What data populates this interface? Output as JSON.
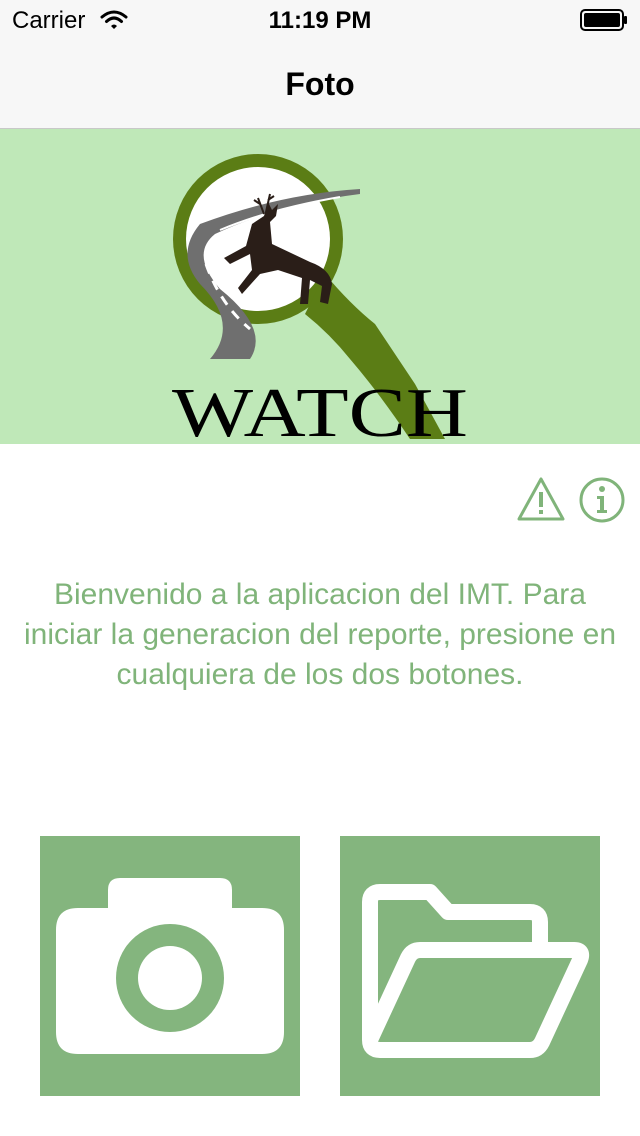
{
  "status_bar": {
    "carrier": "Carrier",
    "time": "11:19 PM"
  },
  "nav": {
    "title": "Foto"
  },
  "logo": {
    "text": "WATCH"
  },
  "welcome_message": "Bienvenido a la aplicacion del IMT. Para iniciar la generacion del reporte, presione en cualquiera de los dos botones.",
  "icons": {
    "warning": "warning-triangle-icon",
    "info": "info-circle-icon",
    "camera": "camera-icon",
    "folder": "open-folder-icon"
  },
  "colors": {
    "header_bg": "#bfe8b8",
    "accent_green": "#84b57e",
    "text_green": "#80b47a",
    "logo_dark_green": "#5b7d15"
  }
}
